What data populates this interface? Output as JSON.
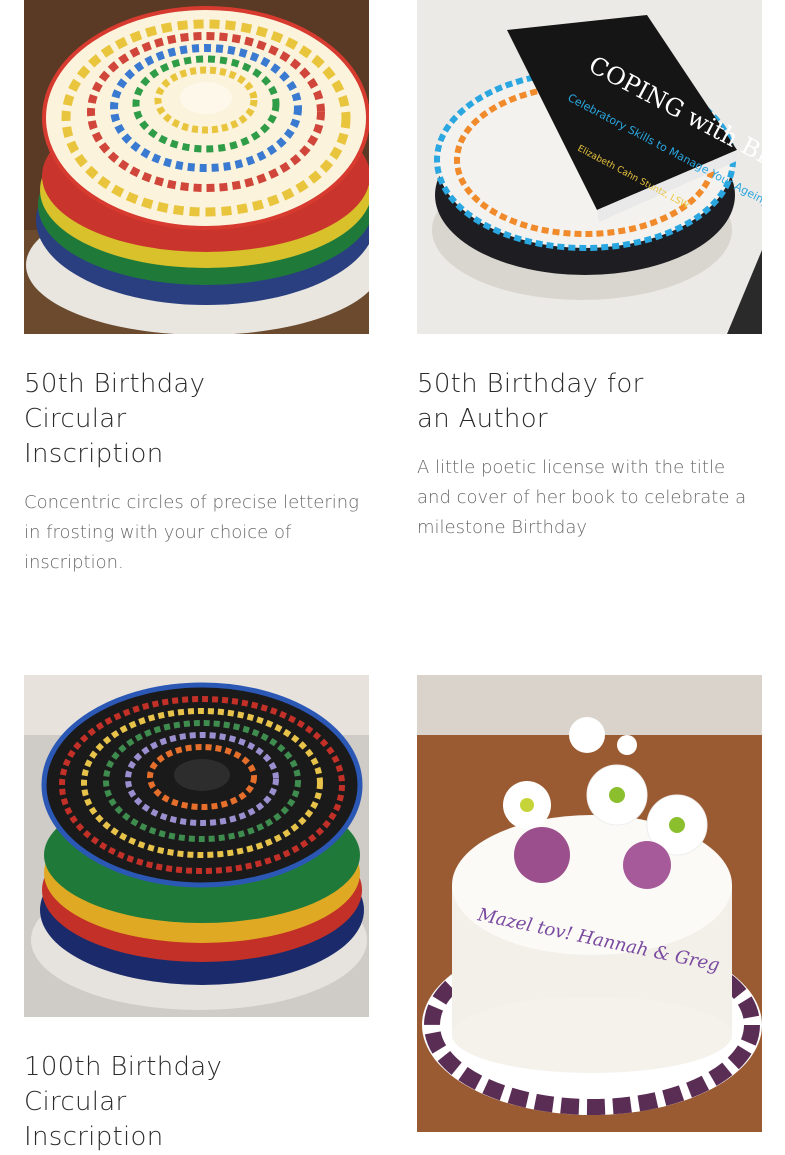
{
  "gallery": {
    "items": [
      {
        "title": "50th Birthday Circular Inscription",
        "description": "Concentric circles of precise lettering in frosting with your choice of inscription.",
        "image": {
          "icon": "cake-photo",
          "text": "HAPPY BIRTHDAY ANNA MARIE 50 50 · FIFTY IS FABULOUS"
        }
      },
      {
        "title": "50th Birthday for an Author",
        "description": "A little poetic license with the title and cover of her book to celebrate a milestone Birthday",
        "image": {
          "icon": "cake-photo",
          "book_title": "COPING with BIRTHDAYS",
          "book_subtitle": "Celebratory Skills to Manage Your Ageing",
          "book_author": "Elizabeth Cahn Stuntz, LSW"
        }
      },
      {
        "title": "100th Birthday Circular Inscription",
        "description": "",
        "image": {
          "icon": "cake-photo",
          "text": "HAPPY BIRTHDAY LUCY LUCIA · 100 100 100 · DRAMATIC PASSIONATE"
        }
      },
      {
        "title": "",
        "description": "",
        "image": {
          "icon": "cake-photo",
          "text": "Mazel tov! Hannah & Greg"
        }
      }
    ]
  },
  "colors": {
    "title": "#2b2b2b",
    "description": "#6a6a6a",
    "background": "#ffffff"
  }
}
